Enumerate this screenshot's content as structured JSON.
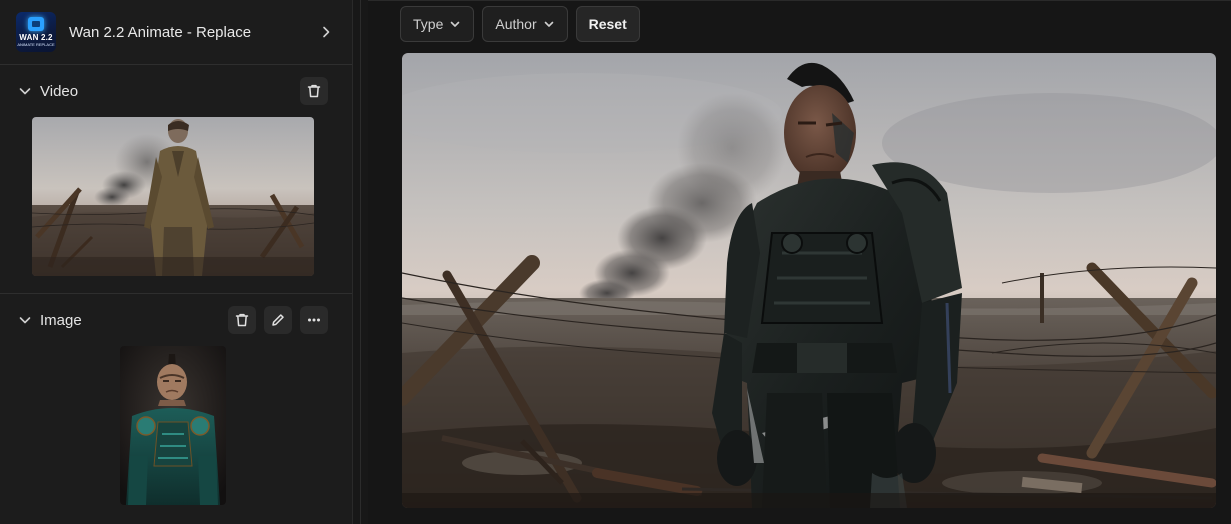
{
  "workflow": {
    "title": "Wan 2.2 Animate - Replace",
    "logo_text": "WAN 2.2",
    "logo_subtext": "ANIMATE REPLACE"
  },
  "sections": {
    "video": {
      "label": "Video"
    },
    "image": {
      "label": "Image"
    }
  },
  "filters": {
    "type_label": "Type",
    "author_label": "Author",
    "reset_label": "Reset"
  },
  "icons": {
    "expand": "chevron-right-icon",
    "collapse": "chevron-down-icon",
    "delete": "trash-icon",
    "edit": "pencil-icon",
    "more": "more-horizontal-icon",
    "dropdown": "chevron-down-icon"
  },
  "colors": {
    "panel_bg": "#1c1c1c",
    "main_bg": "#161616",
    "button_bg": "#2a2a2a",
    "border": "#3a3a3a",
    "logo_accent": "#2aa0ff"
  }
}
